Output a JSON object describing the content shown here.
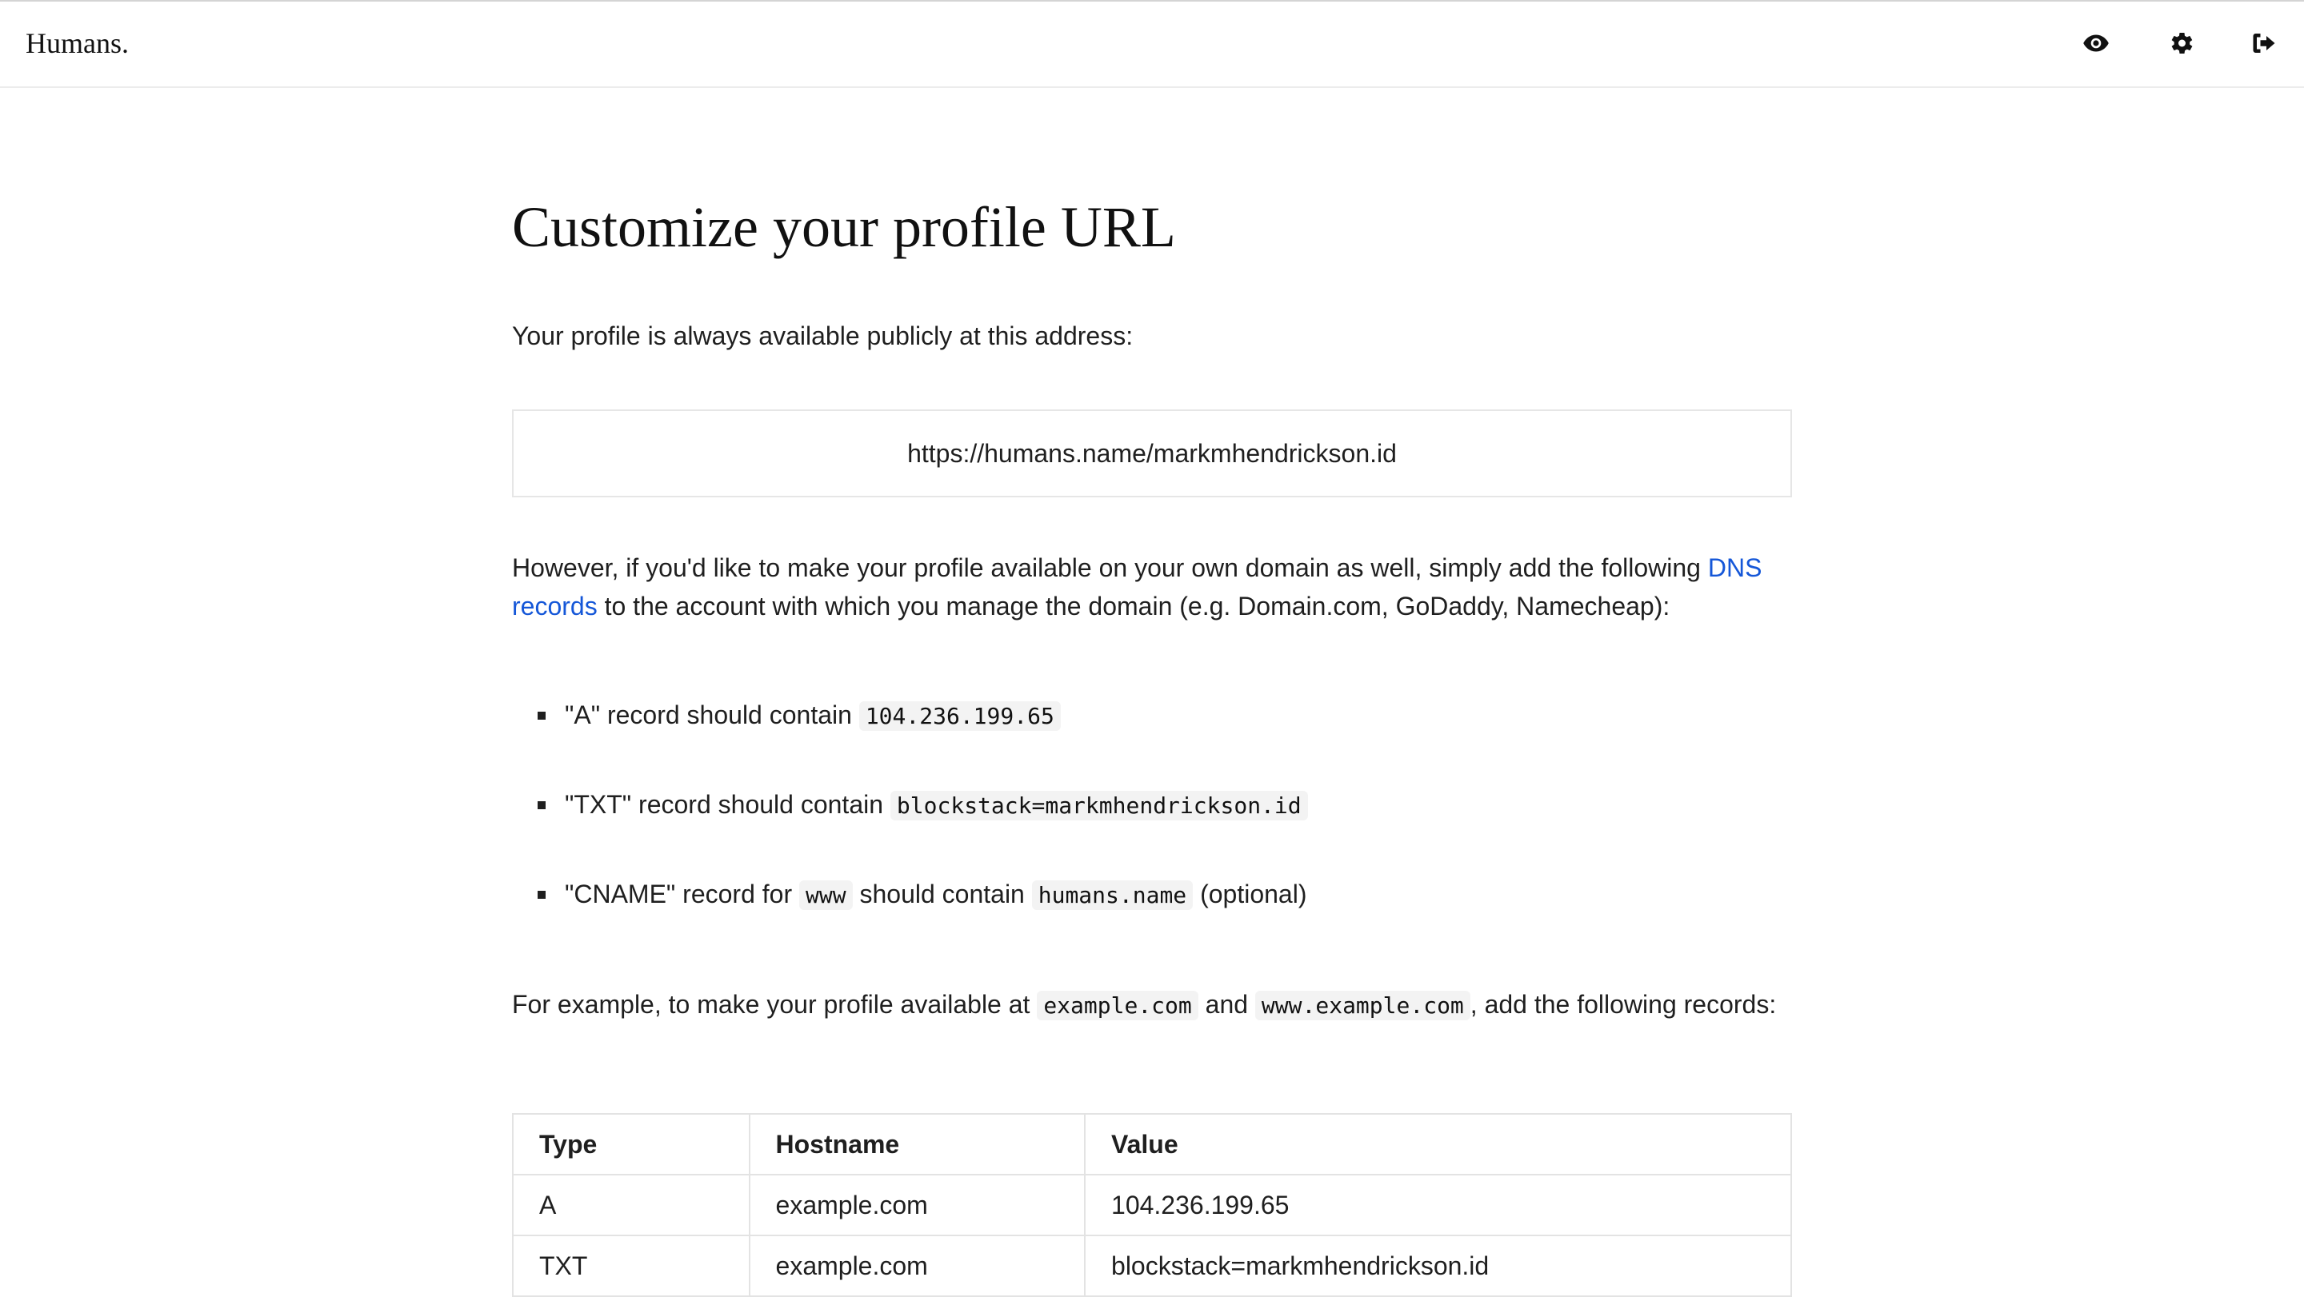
{
  "header": {
    "brand": "Humans.",
    "icons": [
      "eye-icon",
      "gear-icon",
      "sign-out-icon"
    ]
  },
  "main": {
    "title": "Customize your profile URL",
    "intro": "Your profile is always available publicly at this address:",
    "profile_url": "https://humans.name/markmhendrickson.id",
    "para2_before": "However, if you'd like to make your profile available on your own domain as well, simply add the following ",
    "para2_link": "DNS records",
    "para2_after": " to the account with which you manage the domain (e.g. Domain.com, GoDaddy, Namecheap):",
    "records": [
      {
        "pre": "\"A\" record should contain ",
        "code": "104.236.199.65",
        "post": ""
      },
      {
        "pre": "\"TXT\" record should contain ",
        "code": "blockstack=markmhendrickson.id",
        "post": ""
      },
      {
        "pre": "\"CNAME\" record for ",
        "code": "www",
        "mid": " should contain ",
        "code2": "humans.name",
        "post": " (optional)"
      }
    ],
    "example_pre": "For example, to make your profile available at ",
    "example_code1": "example.com",
    "example_mid": " and ",
    "example_code2": "www.example.com",
    "example_post": ", add the following records:",
    "table": {
      "headers": [
        "Type",
        "Hostname",
        "Value"
      ],
      "rows": [
        [
          "A",
          "example.com",
          "104.236.199.65"
        ],
        [
          "TXT",
          "example.com",
          "blockstack=markmhendrickson.id"
        ]
      ]
    }
  }
}
